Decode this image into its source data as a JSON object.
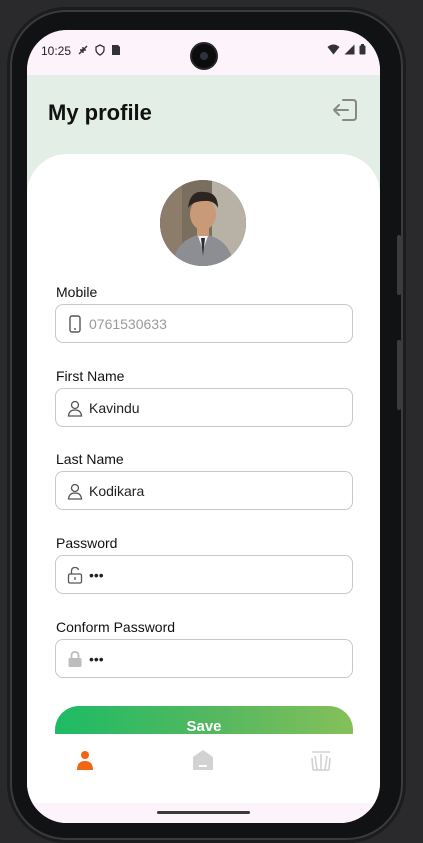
{
  "status_bar": {
    "time": "10:25"
  },
  "header": {
    "title": "My profile",
    "logout_icon": "logout-icon"
  },
  "profile": {
    "avatar_icon": "profile-photo"
  },
  "form": {
    "fields": [
      {
        "label": "Mobile",
        "value": "0761530633",
        "icon": "phone-icon",
        "is_placeholder": true
      },
      {
        "label": "First Name",
        "value": "Kavindu",
        "icon": "user-icon"
      },
      {
        "label": "Last Name",
        "value": "Kodikara",
        "icon": "user-icon"
      },
      {
        "label": "Password",
        "value": "•••",
        "icon": "unlock-icon"
      },
      {
        "label": "Conform Password",
        "value": "•••",
        "icon": "lock-icon"
      }
    ],
    "save_label": "Save"
  },
  "bottom_nav": {
    "items": [
      {
        "icon": "profile-icon",
        "active": true
      },
      {
        "icon": "home-icon",
        "active": false
      },
      {
        "icon": "crop-icon",
        "active": false
      }
    ]
  },
  "colors": {
    "header_bg": "#e2eee6",
    "accent_active": "#f26513",
    "save_gradient_start": "#1dbb64",
    "save_gradient_end": "#85c05a"
  }
}
